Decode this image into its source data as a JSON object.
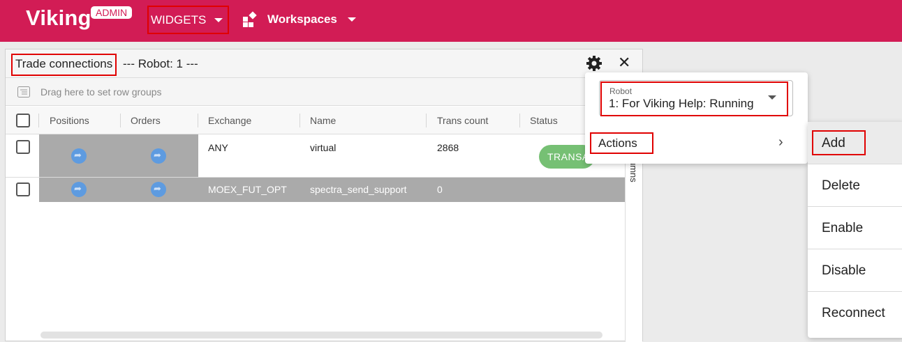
{
  "topbar": {
    "brand": "Viking",
    "badge": "ADMIN",
    "widgets_label": "WIDGETS",
    "workspaces_label": "Workspaces",
    "icons": [
      "caret-down-icon",
      "workspaces-icon"
    ]
  },
  "panel": {
    "title": "Trade connections",
    "subtitle": "--- Robot: 1 ---",
    "group_placeholder": "Drag here to set row groups",
    "side_label": "umns",
    "columns": [
      "Positions",
      "Orders",
      "Exchange",
      "Name",
      "Trans count",
      "Status"
    ],
    "rows": [
      {
        "exchange": "ANY",
        "name": "virtual",
        "trans_count": "2868",
        "status": "TRANSACTIONS"
      },
      {
        "exchange": "MOEX_FUT_OPT",
        "name": "spectra_send_support",
        "trans_count": "0",
        "status": ""
      }
    ]
  },
  "robot_menu": {
    "field_label": "Robot",
    "field_value": "1: For Viking Help: Running",
    "actions_label": "Actions"
  },
  "actions_submenu": {
    "items": [
      "Add",
      "Delete",
      "Enable",
      "Disable",
      "Reconnect"
    ]
  },
  "colors": {
    "topbar": "#d21c55",
    "status_pill": "#76c074",
    "link_icon": "#5e9be0",
    "highlight_box": "#e00000"
  }
}
